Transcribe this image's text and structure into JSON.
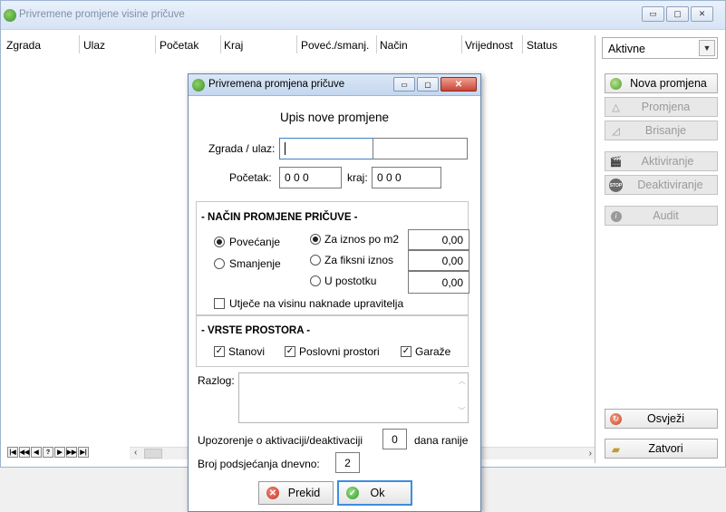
{
  "window": {
    "title": "Privremene promjene visine pričuve",
    "buttons": {
      "minimize": "▭",
      "maximize": "▢",
      "close": "✕"
    }
  },
  "grid": {
    "columns": [
      "Zgrada",
      "Ulaz",
      "Početak",
      "Kraj",
      "Poveć./smanj.",
      "Način",
      "Vrijednost",
      "Status"
    ],
    "nav": [
      "|◀",
      "◀◀",
      "◀",
      "?",
      "▶",
      "▶▶",
      "▶|"
    ]
  },
  "sidebar": {
    "filter_value": "Aktivne",
    "buttons": [
      {
        "label": "Nova promjena",
        "icon": "add-icon",
        "enabled": true
      },
      {
        "label": "Promjena",
        "icon": "edit-icon",
        "enabled": false
      },
      {
        "label": "Brisanje",
        "icon": "erase-icon",
        "enabled": false
      },
      {
        "label": "Aktiviranje",
        "icon": "clapper-icon",
        "enabled": false
      },
      {
        "label": "Deaktiviranje",
        "icon": "stop-icon",
        "enabled": false
      },
      {
        "label": "Audit",
        "icon": "info-icon",
        "enabled": false
      },
      {
        "label": "Osvježi",
        "icon": "refresh-icon",
        "enabled": true
      },
      {
        "label": "Zatvori",
        "icon": "folder-icon",
        "enabled": true
      }
    ]
  },
  "dialog": {
    "title": "Privremena promjena pričuve",
    "heading": "Upis nove promjene",
    "building_label": "Zgrada / ulaz:",
    "building_value": "",
    "entrance_value": "",
    "start_label": "Početak:",
    "start_value": "0 0 0",
    "end_label": "kraj:",
    "end_value": "0 0 0",
    "method_group": "- NAČIN PROMJENE PRIČUVE -",
    "increase_label": "Povećanje",
    "decrease_label": "Smanjenje",
    "per_m2_label": "Za iznos po m2",
    "per_m2_value": "0,00",
    "fixed_label": "Za fiksni iznos",
    "fixed_value": "0,00",
    "percent_label": "U postotku",
    "percent_value": "0,00",
    "affects_fee_label": "Utječe na visinu naknade upravitelja",
    "space_group": "- VRSTE PROSTORA -",
    "apartments_label": "Stanovi",
    "business_label": "Poslovni prostori",
    "garages_label": "Garaže",
    "reason_label": "Razlog:",
    "reason_value": "",
    "warning_label": "Upozorenje o aktivaciji/deaktivaciji",
    "warning_value": "0",
    "warning_suffix": "dana ranije",
    "reminders_label": "Broj podsjećanja dnevno:",
    "reminders_value": "2",
    "cancel_label": "Prekid",
    "ok_label": "Ok"
  }
}
